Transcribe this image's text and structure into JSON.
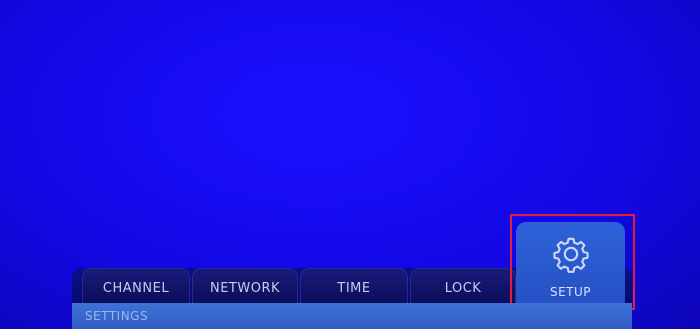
{
  "menu": {
    "tabs": [
      {
        "label": "CHANNEL"
      },
      {
        "label": "NETWORK"
      },
      {
        "label": "TIME"
      },
      {
        "label": "LOCK"
      },
      {
        "label": "SETUP",
        "icon": "gear-icon",
        "selected": true
      }
    ]
  },
  "settings_bar": {
    "label": "SETTINGS"
  },
  "colors": {
    "background": "#1408e6",
    "selected_tab": "#2e62d8",
    "highlight_outline": "#e0203a"
  }
}
